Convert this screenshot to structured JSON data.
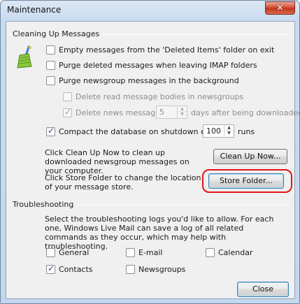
{
  "window": {
    "title": "Maintenance",
    "close_glyph": "✕"
  },
  "cleanup": {
    "legend": "Cleaning Up Messages",
    "empty_deleted": {
      "label": "Empty messages from the 'Deleted Items' folder on exit",
      "checked": false
    },
    "purge_imap": {
      "label": "Purge deleted messages when leaving IMAP folders",
      "checked": false
    },
    "purge_newsgroup": {
      "label": "Purge newsgroup messages in the background",
      "checked": false
    },
    "delete_read_bodies": {
      "label": "Delete read message bodies in newsgroups",
      "checked": false,
      "enabled": false
    },
    "delete_news": {
      "label": "Delete news messages",
      "checked": true,
      "enabled": false,
      "value": "5",
      "suffix": "days after being downloaded"
    },
    "compact": {
      "label": "Compact the database on shutdown every",
      "checked": true,
      "value": "100",
      "suffix": "runs"
    },
    "cleanup_text": "Click Clean Up Now to clean up downloaded newsgroup messages on your computer.",
    "cleanup_button": "Clean Up Now...",
    "store_text": "Click Store Folder to change the location of your message store.",
    "store_button": "Store Folder..."
  },
  "troubleshooting": {
    "legend": "Troubleshooting",
    "description": "Select the troubleshooting logs you'd like to allow. For each one, Windows Live Mail can save a log of all related commands as they occur, which may help with troubleshooting.",
    "logs": [
      {
        "label": "General",
        "checked": false
      },
      {
        "label": "E-mail",
        "checked": false
      },
      {
        "label": "Calendar",
        "checked": false
      },
      {
        "label": "Contacts",
        "checked": true
      },
      {
        "label": "Newsgroups",
        "checked": false
      }
    ]
  },
  "footer": {
    "close_button": "Close"
  },
  "colors": {
    "highlight": "#e0141b",
    "title_bg": "#c9dbef",
    "close_red": "#c3341c"
  },
  "icons": {
    "cleanup_icon": "broom-icon",
    "check": "✓"
  }
}
